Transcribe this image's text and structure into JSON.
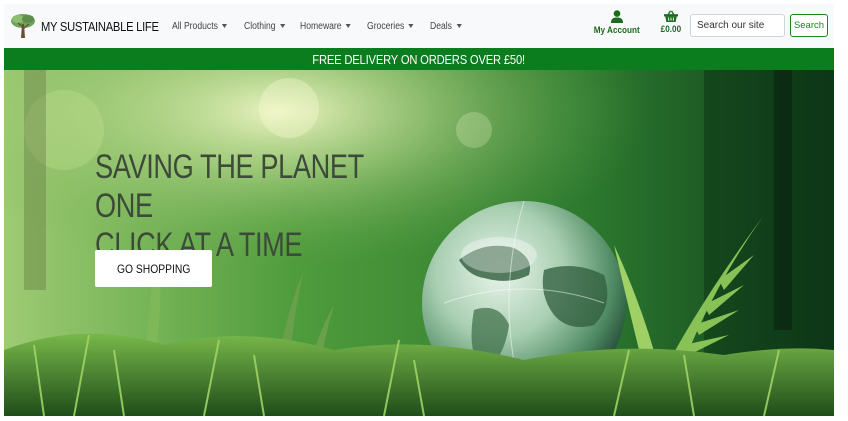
{
  "brand": {
    "name": "MY SUSTAINABLE LIFE",
    "logo_icon": "tree-icon"
  },
  "nav": {
    "items": [
      {
        "label": "All Products"
      },
      {
        "label": "Clothing"
      },
      {
        "label": "Homeware"
      },
      {
        "label": "Groceries"
      },
      {
        "label": "Deals"
      }
    ],
    "dropdown_icon": "caret-down-icon"
  },
  "account": {
    "label": "My Account",
    "icon": "user-icon"
  },
  "basket": {
    "total": "£0.00",
    "icon": "basket-icon"
  },
  "search": {
    "placeholder": "Search our site",
    "value": "",
    "button_label": "Search"
  },
  "promo_banner": {
    "text": "FREE DELIVERY ON ORDERS OVER £50!"
  },
  "hero": {
    "title_line1": "SAVING THE PLANET ONE",
    "title_line2": "CLICK AT A TIME",
    "button_label": "GO SHOPPING"
  },
  "colors": {
    "brand_green": "#0b7d1e",
    "accent_green": "#198a1d",
    "navbar_bg": "#f8f9fa",
    "hero_text": "#3c4a3a"
  }
}
